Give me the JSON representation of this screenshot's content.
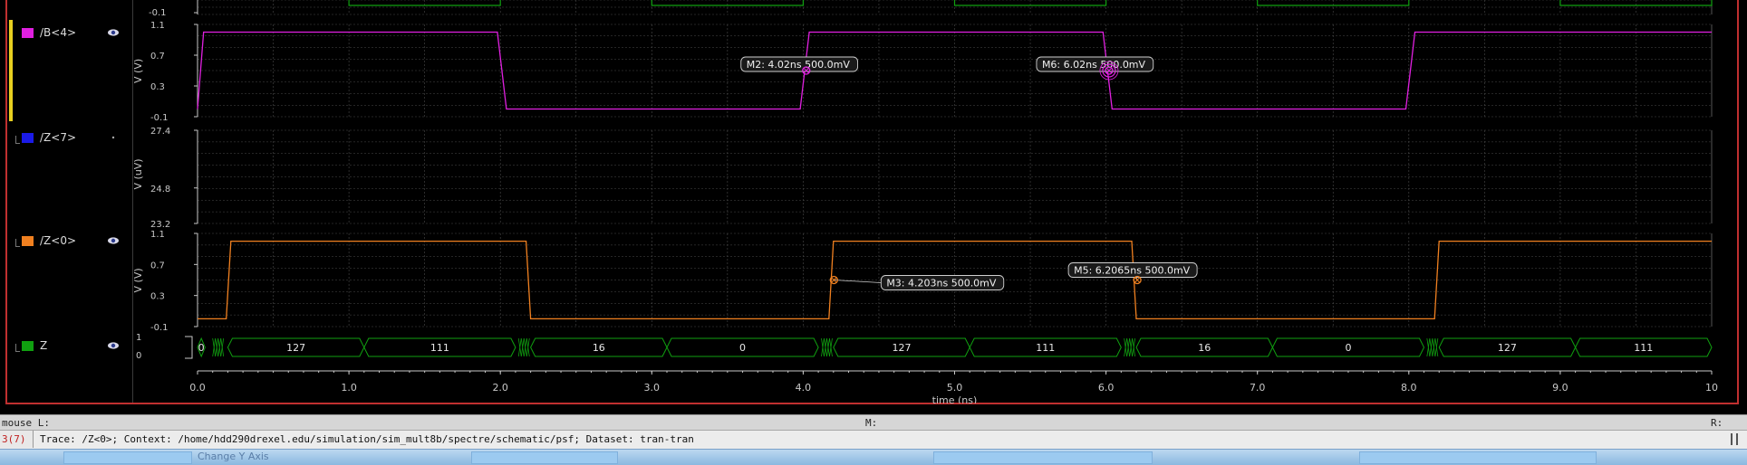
{
  "colors": {
    "magenta": "#e020e0",
    "blue": "#1a1ae8",
    "orange": "#f08020",
    "green": "#10a010",
    "grid": "#4a4a4a",
    "axis": "#c8c8c8",
    "frame": "#c03030"
  },
  "legend": {
    "items": [
      {
        "label": "/B<4>",
        "color": "#e020e0",
        "icon": "eye-icon"
      },
      {
        "label": "/Z<7>",
        "color": "#1a1ae8",
        "icon": "dot-icon"
      },
      {
        "label": "/Z<0>",
        "color": "#f08020",
        "icon": "eye-icon"
      },
      {
        "label": "Z",
        "color": "#10a010",
        "icon": "eye-icon"
      }
    ]
  },
  "axes": {
    "x_label": "time (ns)",
    "x_ticks": [
      "0.0",
      "1.0",
      "2.0",
      "3.0",
      "4.0",
      "5.0",
      "6.0",
      "7.0",
      "8.0",
      "9.0",
      "10"
    ],
    "x_range": [
      0,
      10
    ],
    "top_strip_tick": "-0.1",
    "b4": {
      "ylabel": "V (V)",
      "ticks": [
        "1.1",
        "0.7",
        "0.3",
        "-0.1"
      ],
      "range": [
        -0.1,
        1.1
      ]
    },
    "z7": {
      "ylabel": "V (uV)",
      "ticks": [
        "27.4",
        "24.8",
        "23.2"
      ],
      "range": [
        23.2,
        27.4
      ]
    },
    "z0": {
      "ylabel": "V (V)",
      "ticks": [
        "1.1",
        "0.7",
        "0.3",
        "-0.1"
      ],
      "range": [
        -0.1,
        1.1
      ]
    },
    "bus": {
      "ticks": [
        "1",
        "0"
      ]
    }
  },
  "markers": [
    {
      "label": "M2: 4.02ns 500.0mV",
      "x": 4.02,
      "y": 0.5,
      "strip": "b4"
    },
    {
      "label": "M6: 6.02ns 500.0mV",
      "x": 6.02,
      "y": 0.5,
      "strip": "b4",
      "highlighted": true
    },
    {
      "label": "M3: 4.203ns 500.0mV",
      "x": 4.203,
      "y": 0.5,
      "strip": "z0"
    },
    {
      "label": "M5: 6.2065ns 500.0mV",
      "x": 6.2065,
      "y": 0.5,
      "strip": "z0"
    }
  ],
  "chart_data": {
    "type": "line",
    "title": "",
    "xlabel": "time (ns)",
    "xlim": [
      0,
      10
    ],
    "series": [
      {
        "name": "/B<4>",
        "strip": "b4",
        "ylabel": "V (V)",
        "ylim": [
          -0.1,
          1.1
        ],
        "points": [
          [
            0.0,
            0.0
          ],
          [
            0.04,
            1.0
          ],
          [
            1.98,
            1.0
          ],
          [
            2.04,
            0.0
          ],
          [
            3.98,
            0.0
          ],
          [
            4.04,
            1.0
          ],
          [
            5.98,
            1.0
          ],
          [
            6.04,
            0.0
          ],
          [
            7.98,
            0.0
          ],
          [
            8.04,
            1.0
          ],
          [
            10.0,
            1.0
          ]
        ]
      },
      {
        "name": "/Z<7>",
        "strip": "z7",
        "ylabel": "V (uV)",
        "ylim": [
          23.2,
          27.4
        ],
        "points": []
      },
      {
        "name": "/Z<0>",
        "strip": "z0",
        "ylabel": "V (V)",
        "ylim": [
          -0.1,
          1.1
        ],
        "points": [
          [
            0.0,
            0.0
          ],
          [
            0.19,
            0.0
          ],
          [
            0.22,
            1.0
          ],
          [
            2.17,
            1.0
          ],
          [
            2.2,
            0.0
          ],
          [
            4.17,
            0.0
          ],
          [
            4.2,
            1.0
          ],
          [
            6.17,
            1.0
          ],
          [
            6.2,
            0.0
          ],
          [
            8.17,
            0.0
          ],
          [
            8.2,
            1.0
          ],
          [
            10.0,
            1.0
          ]
        ]
      },
      {
        "name": "Z",
        "strip": "bus",
        "type": "bus",
        "segments": [
          {
            "start": 0.0,
            "end": 0.05,
            "label": "0"
          },
          {
            "start": 0.2,
            "end": 1.1,
            "label": "127"
          },
          {
            "start": 1.1,
            "end": 2.1,
            "label": "111"
          },
          {
            "start": 2.2,
            "end": 3.1,
            "label": "16"
          },
          {
            "start": 3.1,
            "end": 4.1,
            "label": "0"
          },
          {
            "start": 4.2,
            "end": 5.1,
            "label": "127"
          },
          {
            "start": 5.1,
            "end": 6.1,
            "label": "111"
          },
          {
            "start": 6.2,
            "end": 7.1,
            "label": "16"
          },
          {
            "start": 7.1,
            "end": 8.1,
            "label": "0"
          },
          {
            "start": 8.2,
            "end": 9.1,
            "label": "127"
          },
          {
            "start": 9.1,
            "end": 10.0,
            "label": "111"
          }
        ]
      }
    ]
  },
  "status": {
    "mouse": "mouse L:",
    "middle": "M:",
    "right": "R:",
    "counter": "3(7)",
    "message": "Trace: /Z<0>; Context: /home/hdd290drexel.edu/simulation/sim_mult8b/spectre/schematic/psf; Dataset: tran-tran"
  },
  "taskbar": {
    "ghost_label": "Change Y Axis"
  }
}
